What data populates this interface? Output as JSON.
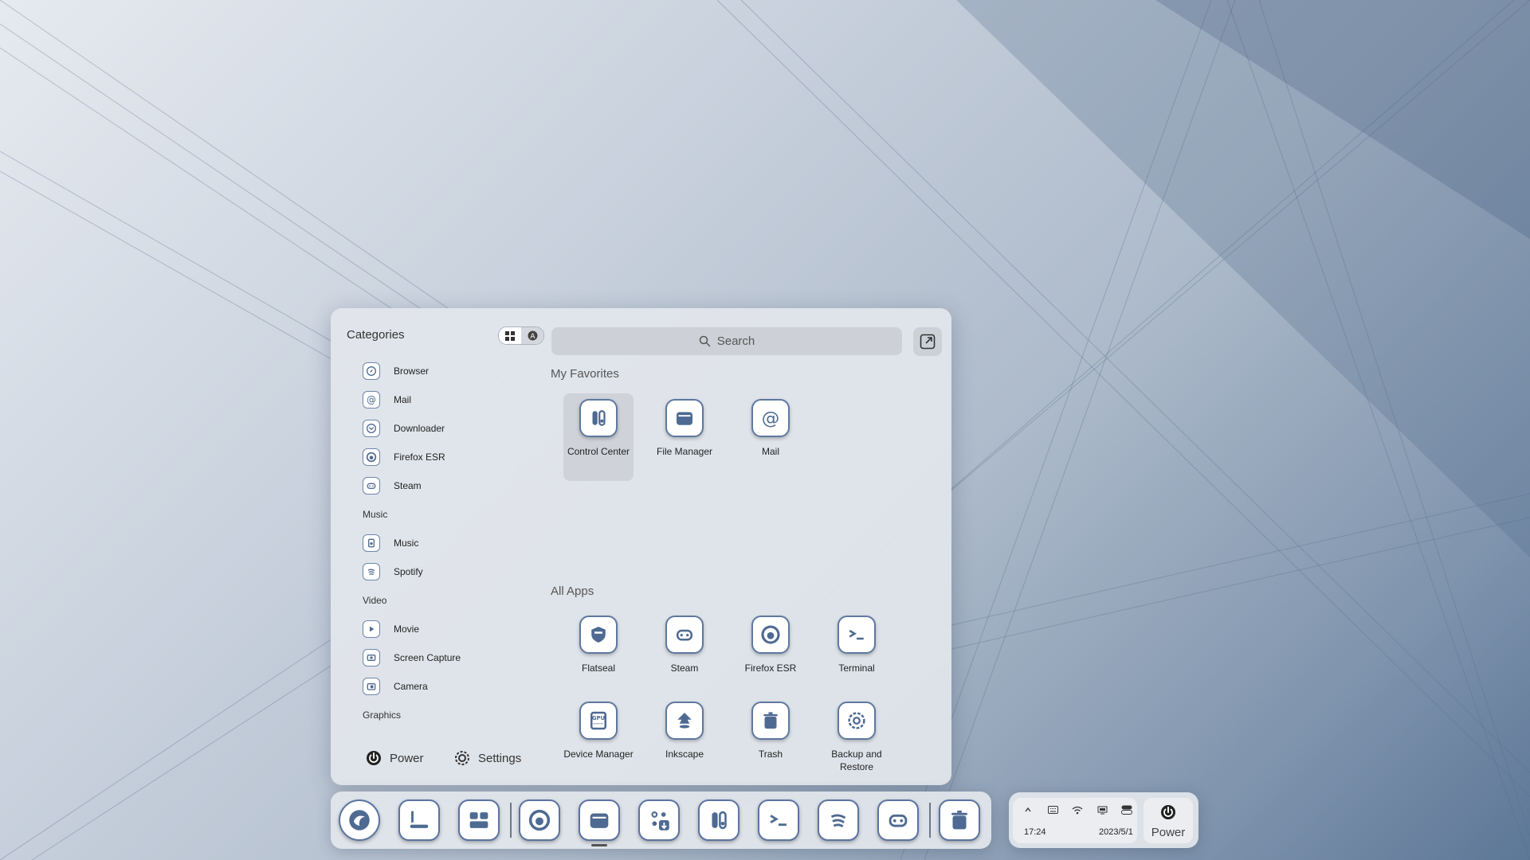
{
  "launcher": {
    "categories_title": "Categories",
    "search_placeholder": "Search",
    "favorites_title": "My Favorites",
    "all_apps_title": "All Apps",
    "categories": [
      {
        "type": "app",
        "label": "Browser",
        "icon": "browser-icon"
      },
      {
        "type": "app",
        "label": "Mail",
        "icon": "mail-icon"
      },
      {
        "type": "app",
        "label": "Downloader",
        "icon": "downloader-icon"
      },
      {
        "type": "app",
        "label": "Firefox ESR",
        "icon": "firefox-icon"
      },
      {
        "type": "app",
        "label": "Steam",
        "icon": "steam-icon"
      },
      {
        "type": "header",
        "label": "Music"
      },
      {
        "type": "app",
        "label": "Music",
        "icon": "music-icon"
      },
      {
        "type": "app",
        "label": "Spotify",
        "icon": "spotify-icon"
      },
      {
        "type": "header",
        "label": "Video"
      },
      {
        "type": "app",
        "label": "Movie",
        "icon": "movie-icon"
      },
      {
        "type": "app",
        "label": "Screen Capture",
        "icon": "screen-capture-icon"
      },
      {
        "type": "app",
        "label": "Camera",
        "icon": "camera-icon"
      },
      {
        "type": "header",
        "label": "Graphics"
      }
    ],
    "favorites": [
      {
        "label": "Control Center",
        "icon": "control-center-icon",
        "highlighted": true
      },
      {
        "label": "File Manager",
        "icon": "file-manager-icon",
        "highlighted": false
      },
      {
        "label": "Mail",
        "icon": "mail-icon",
        "highlighted": false
      }
    ],
    "all_apps": [
      {
        "label": "Flatseal",
        "icon": "flatseal-icon"
      },
      {
        "label": "Steam",
        "icon": "steam-icon"
      },
      {
        "label": "Firefox ESR",
        "icon": "firefox-icon"
      },
      {
        "label": "Terminal",
        "icon": "terminal-icon"
      },
      {
        "label": "Device Manager",
        "icon": "device-manager-icon"
      },
      {
        "label": "Inkscape",
        "icon": "inkscape-icon"
      },
      {
        "label": "Trash",
        "icon": "trash-icon"
      },
      {
        "label": "Backup and Restore",
        "icon": "backup-restore-icon"
      }
    ],
    "power_label": "Power",
    "settings_label": "Settings"
  },
  "dock": {
    "items": [
      {
        "name": "launcher",
        "icon": "deepin-launcher-icon"
      },
      {
        "name": "show-desktop",
        "icon": "show-desktop-icon"
      },
      {
        "name": "multitasking",
        "icon": "multitasking-icon"
      },
      {
        "name": "firefox",
        "icon": "firefox-icon"
      },
      {
        "name": "file-manager",
        "icon": "file-manager-icon",
        "active": true
      },
      {
        "name": "app-store",
        "icon": "app-store-icon"
      },
      {
        "name": "control-center",
        "icon": "control-center-icon"
      },
      {
        "name": "terminal",
        "icon": "terminal-icon"
      },
      {
        "name": "spotify",
        "icon": "spotify-icon"
      },
      {
        "name": "steam",
        "icon": "steam-icon"
      },
      {
        "name": "trash",
        "icon": "trash-icon"
      }
    ]
  },
  "tray": {
    "time": "17:24",
    "date": "2023/5/1",
    "power_label": "Power",
    "icons": [
      "chevron-up-icon",
      "keyboard-icon",
      "wifi-icon",
      "screen-icon",
      "toggle-icon"
    ]
  },
  "colors": {
    "accent": "#5b73a0",
    "panel_bg": "#e2e6ec"
  }
}
